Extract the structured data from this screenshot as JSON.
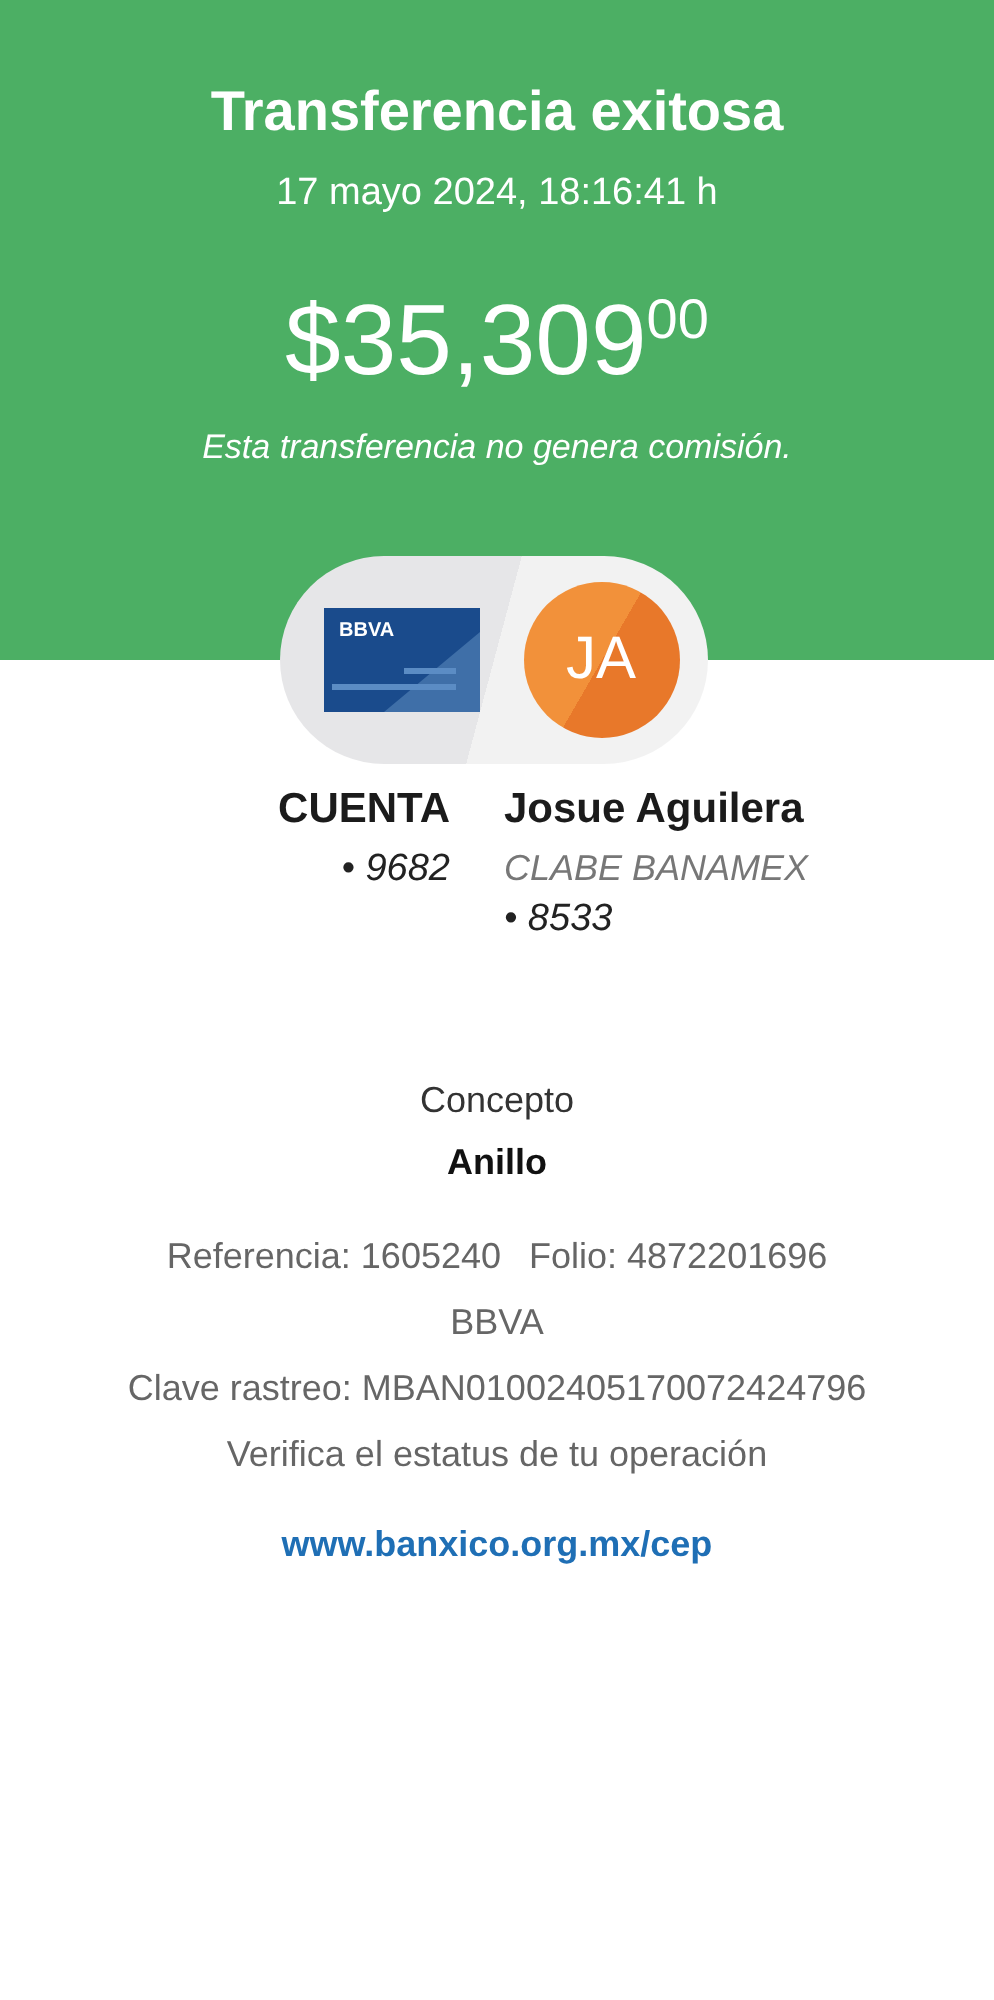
{
  "header": {
    "title": "Transferencia exitosa",
    "datetime": "17 mayo 2024, 18:16:41 h",
    "amount": "$35,309",
    "amount_cents": "00",
    "note": "Esta transferencia no genera comisión."
  },
  "origin": {
    "card_brand": "BBVA",
    "label": "CUENTA",
    "account": "• 9682"
  },
  "destination": {
    "initials": "JA",
    "name": "Josue Aguilera",
    "bank": "CLABE BANAMEX",
    "account": "• 8533"
  },
  "concept": {
    "label": "Concepto",
    "value": "Anillo"
  },
  "details": {
    "reference": "Referencia: 1605240",
    "folio": "Folio: 4872201696",
    "bank": "BBVA",
    "tracking": "Clave rastreo: MBAN01002405170072424796",
    "verify": "Verifica el estatus de tu operación",
    "link": "www.banxico.org.mx/cep"
  }
}
